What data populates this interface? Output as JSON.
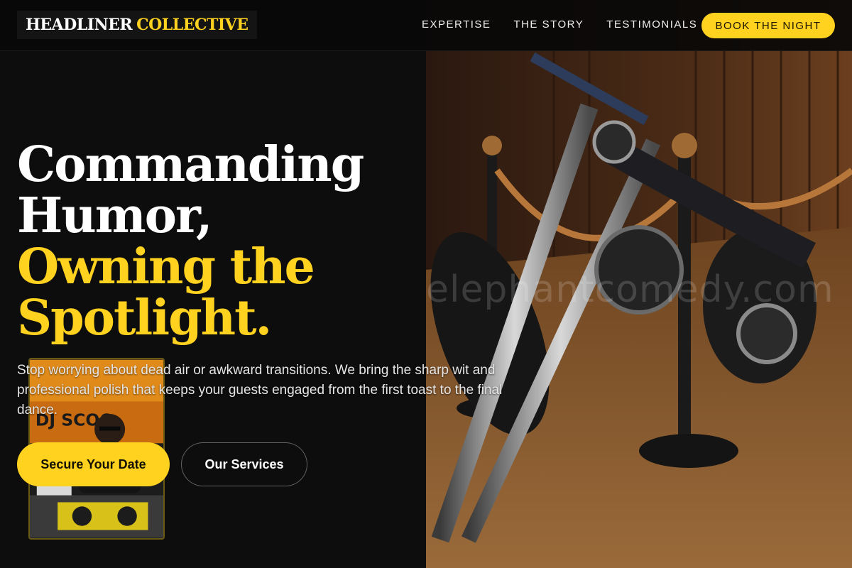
{
  "header": {
    "logo_primary": "HEADLINER",
    "logo_accent": "COLLECTIVE",
    "nav": [
      {
        "label": "EXPERTISE"
      },
      {
        "label": "THE STORY"
      },
      {
        "label": "TESTIMONIALS"
      }
    ],
    "cta_label": "BOOK THE NIGHT"
  },
  "hero": {
    "title_lines": [
      "Commanding",
      "Humor,",
      "Owning the",
      "Spotlight."
    ],
    "lede": "Stop worrying about dead air or awkward transitions. We bring the sharp wit and professional polish that keeps your guests engaged from the first toast to the final dance.",
    "primary_cta": "Secure Your Date",
    "secondary_cta": "Our Services",
    "thumbnail_text": "DJ SCOO",
    "watermark": "elephantcomedy.com"
  },
  "colors": {
    "accent": "#ffd21f",
    "background": "#0d0d0d"
  },
  "icons": {
    "photo": "motorcycle-photo",
    "thumbnail": "dj-performer-photo"
  }
}
